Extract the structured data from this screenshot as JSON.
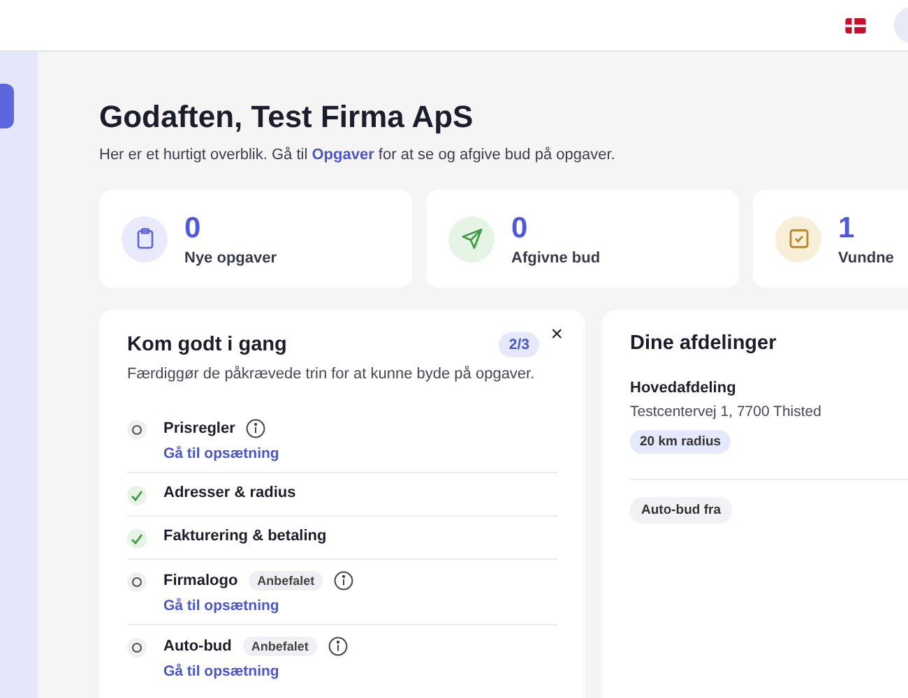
{
  "greeting": {
    "title": "Godaften, Test Firma ApS",
    "intro_before": "Her er et hurtigt overblik. Gå til",
    "intro_link": "Opgaver",
    "intro_after": "for at se og afgive bud på opgaver."
  },
  "stats": [
    {
      "kind": "clipboard",
      "value": "0",
      "label": "Nye opgaver"
    },
    {
      "kind": "send",
      "value": "0",
      "label": "Afgivne bud"
    },
    {
      "kind": "check",
      "value": "1",
      "label": "Vundne"
    }
  ],
  "onboarding": {
    "title": "Kom godt i gang",
    "progress": "2/3",
    "close": "×",
    "description": "Færdiggør de påkrævede trin for at kunne byde på opgaver.",
    "steps": [
      {
        "label": "Prisregler",
        "done": false,
        "info": true,
        "link": "Gå til opsætning"
      },
      {
        "label": "Adresser & radius",
        "done": true,
        "info": false
      },
      {
        "label": "Fakturering & betaling",
        "done": true,
        "info": false
      },
      {
        "label": "Firmalogo",
        "done": false,
        "badge": "Anbefalet",
        "info": true,
        "link": "Gå til opsætning"
      },
      {
        "label": "Auto-bud",
        "done": false,
        "badge": "Anbefalet",
        "info": true,
        "link": "Gå til opsætning"
      }
    ]
  },
  "departments": {
    "title": "Dine afdelinger",
    "items": [
      {
        "name": "Hovedafdeling",
        "address": "Testcentervej 1, 7700 Thisted",
        "radius": "20 km radius"
      }
    ],
    "autobid": "Auto-bud fra"
  }
}
